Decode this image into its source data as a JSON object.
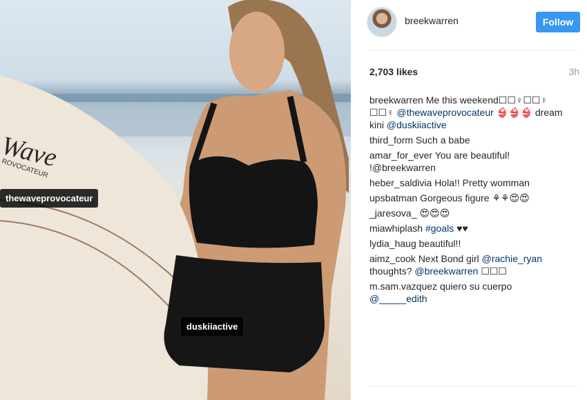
{
  "photo": {
    "tags": [
      "thewaveprovocateur",
      "duskiiactive"
    ],
    "board_lettering": [
      "Wave",
      "ROVOCATEUR"
    ]
  },
  "header": {
    "username": "breekwarren",
    "follow_label": "Follow"
  },
  "stats": {
    "likes": "2,703 likes",
    "time": "3h"
  },
  "comments": [
    {
      "user": "breekwarren",
      "text": "Me this weekend☐☐♀☐☐♀ ☐☐♀",
      "mention": "@thewaveprovocateur",
      "text2": "👙👙👙 dream kini",
      "mention2": "@duskiiactive"
    },
    {
      "user": "third_form",
      "text": "Such a babe"
    },
    {
      "user": "amar_for_ever",
      "text": "You are beautiful! !@breekwarren"
    },
    {
      "user": "heber_saldivia",
      "text": "Hola!! Pretty womman"
    },
    {
      "user": "upsbatman",
      "text": "Gorgeous figure ⚘⚘😍😍"
    },
    {
      "user": "_jaresova_",
      "text": "😍😍😍"
    },
    {
      "user": "miawhiplash",
      "mention": "#goals",
      "text2": "♥♥"
    },
    {
      "user": "lydia_haug",
      "text": "beautiful!!"
    },
    {
      "user": "aimz_cook",
      "text": "Next Bond girl",
      "mention": "@rachie_ryan",
      "text2": "thoughts?",
      "mention2": "@breekwarren",
      "text3": "☐☐☐"
    },
    {
      "user": "m.sam.vazquez",
      "text": "quiero su cuerpo",
      "mention": "@_____edith"
    }
  ]
}
